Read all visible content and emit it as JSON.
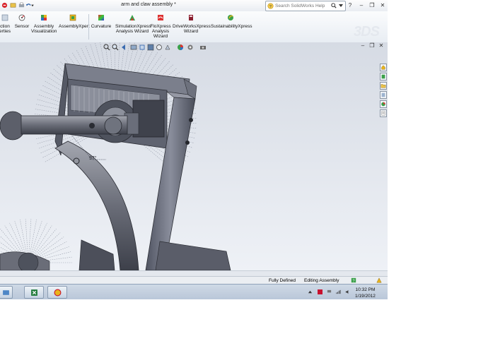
{
  "window": {
    "title": "arm and claw assembly *",
    "search_placeholder": "Search SolidWorks Help",
    "minimize": "–",
    "restore": "❐",
    "close": "✕",
    "help": "?"
  },
  "ribbon": {
    "items": [
      {
        "label_line1": "ction",
        "label_line2": "erties",
        "icon": "section-properties-icon"
      },
      {
        "label_line1": "Sensor",
        "label_line2": "",
        "icon": "sensor-icon"
      },
      {
        "label_line1": "Assembly",
        "label_line2": "Visualization",
        "icon": "assembly-visualization-icon"
      },
      {
        "label_line1": "AssemblyXpert",
        "label_line2": "",
        "icon": "assemblyxpert-icon"
      },
      {
        "label_line1": "Curvature",
        "label_line2": "",
        "icon": "curvature-icon"
      },
      {
        "label_line1": "SimulationXpress",
        "label_line2": "Analysis Wizard",
        "icon": "simulationxpress-icon"
      },
      {
        "label_line1": "FloXpress",
        "label_line2": "Analysis",
        "label_line3": "Wizard",
        "icon": "floxpress-icon"
      },
      {
        "label_line1": "DriveWorksXpress",
        "label_line2": "Wizard",
        "icon": "driveworksxpress-icon"
      },
      {
        "label_line1": "SustainabilityXpress",
        "label_line2": "",
        "icon": "sustainabilityxpress-icon"
      }
    ]
  },
  "viewport": {
    "annotation": "97°"
  },
  "status": {
    "state": "Fully Defined",
    "mode": "Editing Assembly"
  },
  "taskbar": {
    "time": "10:32 PM",
    "date": "1/19/2012",
    "apps": [
      "windows-explorer-icon",
      "excel-icon",
      "solidworks-icon"
    ]
  },
  "colors": {
    "accent": "#c8102e",
    "viewport_bg": "#e2e6ed",
    "model_gray": "#6e7280"
  }
}
